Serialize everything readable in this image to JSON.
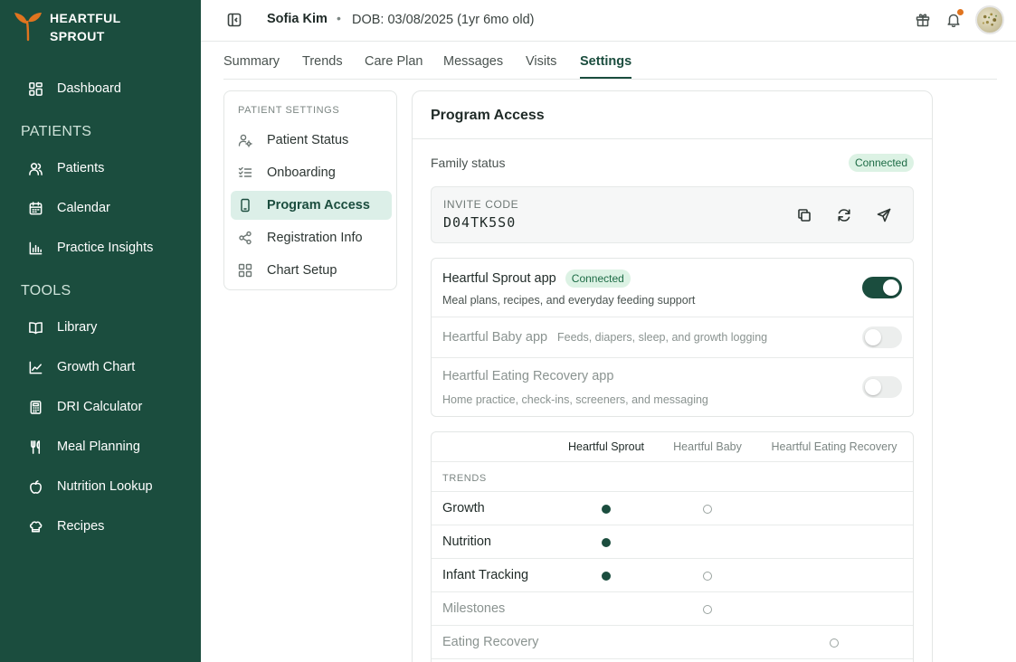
{
  "brand": {
    "line1": "HEARTFUL",
    "line2": "SPROUT",
    "accent_color": "#e0741f",
    "sidebar_color": "#1b4d3e"
  },
  "sidebar": {
    "dashboard": {
      "label": "Dashboard",
      "icon": "grid-icon"
    },
    "patients_section": "PATIENTS",
    "patients_items": [
      {
        "label": "Patients",
        "icon": "users-icon"
      },
      {
        "label": "Calendar",
        "icon": "calendar-icon"
      },
      {
        "label": "Practice Insights",
        "icon": "bar-chart-icon"
      }
    ],
    "tools_section": "TOOLS",
    "tools_items": [
      {
        "label": "Library",
        "icon": "book-icon"
      },
      {
        "label": "Growth Chart",
        "icon": "line-chart-icon"
      },
      {
        "label": "DRI Calculator",
        "icon": "calculator-icon"
      },
      {
        "label": "Meal Planning",
        "icon": "utensils-icon"
      },
      {
        "label": "Nutrition Lookup",
        "icon": "apple-icon"
      },
      {
        "label": "Recipes",
        "icon": "chef-hat-icon"
      }
    ]
  },
  "header": {
    "patient_name": "Sofia Kim",
    "separator": "•",
    "dob": "DOB: 03/08/2025 (1yr 6mo old)"
  },
  "tabs": [
    {
      "label": "Summary",
      "active": false
    },
    {
      "label": "Trends",
      "active": false
    },
    {
      "label": "Care Plan",
      "active": false
    },
    {
      "label": "Messages",
      "active": false
    },
    {
      "label": "Visits",
      "active": false
    },
    {
      "label": "Settings",
      "active": true
    }
  ],
  "settings_nav": {
    "title": "PATIENT SETTINGS",
    "items": [
      {
        "label": "Patient Status",
        "icon": "user-cog-icon",
        "active": false
      },
      {
        "label": "Onboarding",
        "icon": "checklist-icon",
        "active": false
      },
      {
        "label": "Program Access",
        "icon": "phone-icon",
        "active": true
      },
      {
        "label": "Registration Info",
        "icon": "share-icon",
        "active": false
      },
      {
        "label": "Chart Setup",
        "icon": "layout-icon",
        "active": false
      }
    ]
  },
  "program_access": {
    "title": "Program Access",
    "family_status_label": "Family status",
    "family_status": "Connected",
    "invite_label": "INVITE CODE",
    "invite_code": "D04TK5S0",
    "apps": [
      {
        "name": "Heartful Sprout app",
        "badge": "Connected",
        "description": "Meal plans, recipes, and everyday feeding support",
        "enabled": true
      },
      {
        "name": "Heartful Baby app",
        "badge": "",
        "description": "Feeds, diapers, sleep, and growth logging",
        "enabled": false
      },
      {
        "name": "Heartful Eating Recovery app",
        "badge": "",
        "description": "Home practice, check-ins, screeners, and messaging",
        "enabled": false
      }
    ],
    "matrix": {
      "columns": [
        "Heartful Sprout",
        "Heartful Baby",
        "Heartful Eating Recovery"
      ],
      "section": "TRENDS",
      "rows": [
        {
          "label": "Growth",
          "muted": false,
          "cells": [
            "filled",
            "hollow",
            ""
          ]
        },
        {
          "label": "Nutrition",
          "muted": false,
          "cells": [
            "filled",
            "",
            ""
          ]
        },
        {
          "label": "Infant Tracking",
          "muted": false,
          "cells": [
            "filled",
            "hollow",
            ""
          ]
        },
        {
          "label": "Milestones",
          "muted": true,
          "cells": [
            "",
            "hollow",
            ""
          ]
        },
        {
          "label": "Eating Recovery",
          "muted": true,
          "cells": [
            "",
            "",
            "hollow"
          ]
        }
      ]
    }
  }
}
